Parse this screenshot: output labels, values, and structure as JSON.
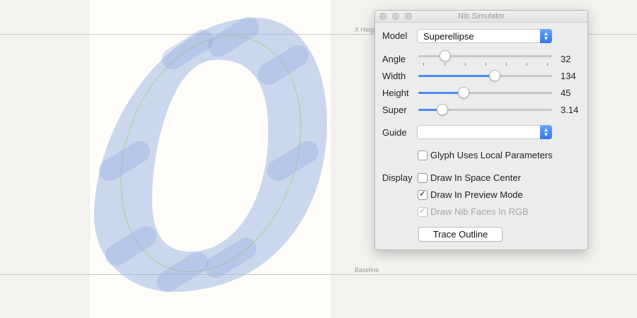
{
  "metrics": {
    "xheight_label": "X Height",
    "baseline_label": "Baseline"
  },
  "panel": {
    "title": "Nib Simulator",
    "model": {
      "label": "Model",
      "value": "Superellipse"
    },
    "sliders": [
      {
        "label": "Angle",
        "value": "32",
        "fraction": 0.2
      },
      {
        "label": "Width",
        "value": "134",
        "fraction": 0.57
      },
      {
        "label": "Height",
        "value": "45",
        "fraction": 0.34
      },
      {
        "label": "Super",
        "value": "3.14",
        "fraction": 0.18
      }
    ],
    "guide": {
      "label": "Guide",
      "value": ""
    },
    "glyph_local": {
      "label": "Glyph Uses Local Parameters",
      "checked": false
    },
    "display": {
      "label": "Display",
      "space_center": {
        "label": "Draw In Space Center",
        "checked": false
      },
      "preview_mode": {
        "label": "Draw In Preview Mode",
        "checked": true
      },
      "nib_faces": {
        "label": "Draw Nib Faces In RGB",
        "checked": true,
        "disabled": true
      }
    },
    "trace_button": "Trace Outline"
  },
  "colors": {
    "accent": "#4c8cf3",
    "nib": "#8fa9de",
    "guide_curve": "#a9d38f"
  }
}
